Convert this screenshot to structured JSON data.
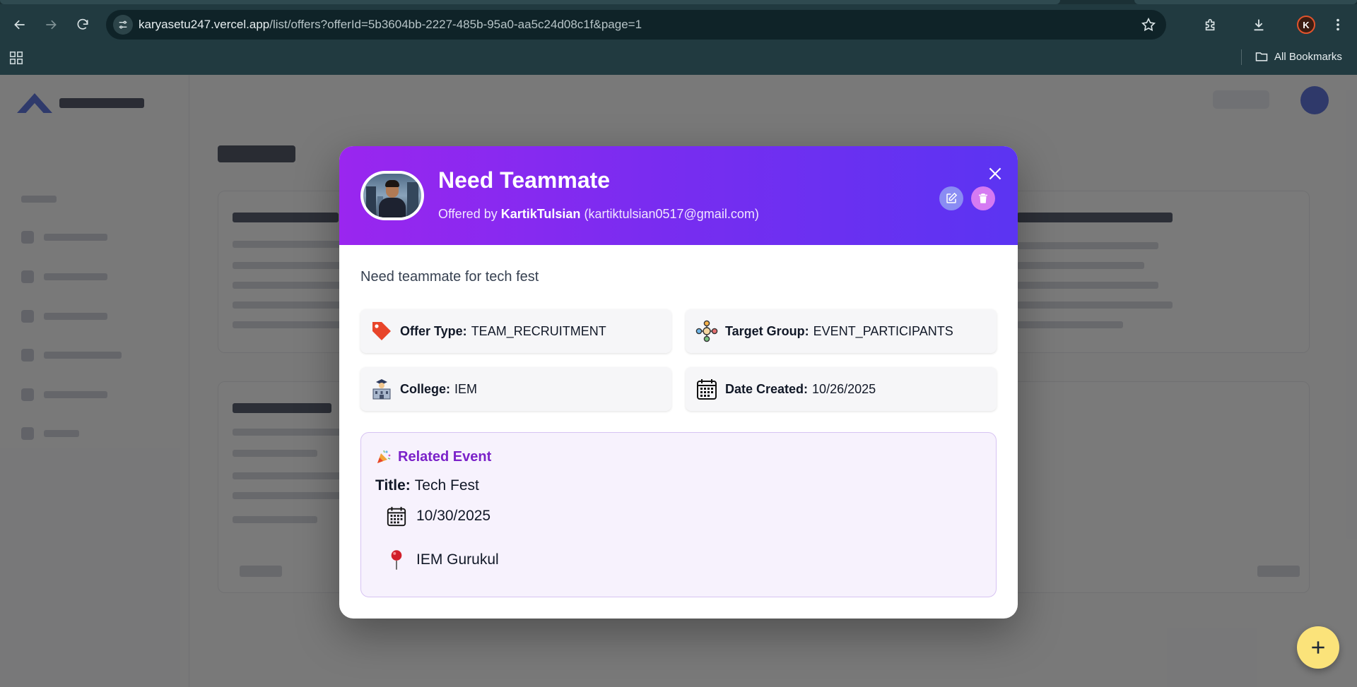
{
  "browser": {
    "url_host": "karyasetu247.vercel.app",
    "url_path": "/list/offers?offerId=5b3604bb-2227-485b-95a0-aa5c24d08c1f&page=1",
    "profile_initial": "K",
    "bookmarks_label": "All Bookmarks"
  },
  "modal": {
    "title": "Need Teammate",
    "offered_by_prefix": "Offered by",
    "offered_by_name": "KartikTulsian",
    "offered_by_email": "(kartiktulsian0517@gmail.com)",
    "description": "Need teammate for tech fest",
    "info": [
      {
        "label": "Offer Type:",
        "value": "TEAM_RECRUITMENT",
        "icon": "tag-icon"
      },
      {
        "label": "Target Group:",
        "value": "EVENT_PARTICIPANTS",
        "icon": "group-icon"
      },
      {
        "label": "College:",
        "value": "IEM",
        "icon": "college-icon"
      },
      {
        "label": "Date Created:",
        "value": "10/26/2025",
        "icon": "calendar-icon"
      }
    ],
    "related_event": {
      "heading": "Related Event",
      "title_label": "Title:",
      "title_value": "Tech Fest",
      "date": "10/30/2025",
      "location": "IEM Gurukul"
    }
  },
  "colors": {
    "header_gradient_start": "#9a26ef",
    "header_gradient_end": "#5b34f2",
    "event_accent": "#7b22c9",
    "fab": "#fbe37a"
  }
}
